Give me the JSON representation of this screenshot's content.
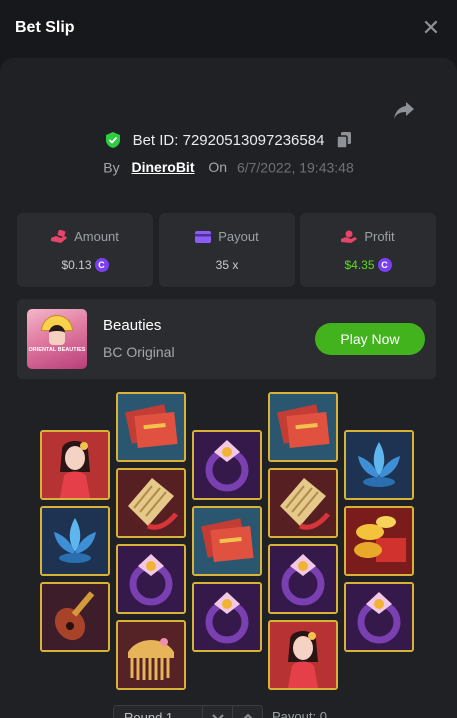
{
  "header": {
    "title": "Bet Slip",
    "close_icon": "close-icon"
  },
  "bet": {
    "id_text": "Bet ID: 72920513097236584",
    "by_label": "By",
    "user": "DineroBit",
    "on_label": "On",
    "date": "6/7/2022, 19:43:48",
    "verified_color": "#2ecc40"
  },
  "stats": {
    "amount": {
      "label": "Amount",
      "value": "$0.13",
      "icon": "money-hand-icon",
      "icon_color": "#e8446a"
    },
    "payout": {
      "label": "Payout",
      "value": "35 x",
      "icon": "card-icon",
      "icon_color": "#8b5cf6"
    },
    "profit": {
      "label": "Profit",
      "value": "$4.35",
      "icon": "profit-hand-icon",
      "icon_color": "#e8446a",
      "value_color": "#5ddb1c"
    },
    "currency_icon": "coin-icon",
    "currency_color": "#7b3ff2"
  },
  "game": {
    "thumb_text": "ORIENTAL BEAUTIES",
    "name": "Beauties",
    "subtitle": "BC Original",
    "play_label": "Play Now",
    "play_color": "#43b31d"
  },
  "grid": {
    "columns": [
      [
        "beauty",
        "lotus",
        "pipa"
      ],
      [
        "book",
        "fan",
        "ring",
        "comb"
      ],
      [
        "ring",
        "book",
        "ring"
      ],
      [
        "book",
        "fan",
        "ring",
        "beauty"
      ],
      [
        "lotus",
        "gold",
        "ring"
      ]
    ],
    "border_color": "#d9b23a"
  },
  "footer": {
    "round_label": "Round 1",
    "payout_label": "Payout: 0"
  }
}
